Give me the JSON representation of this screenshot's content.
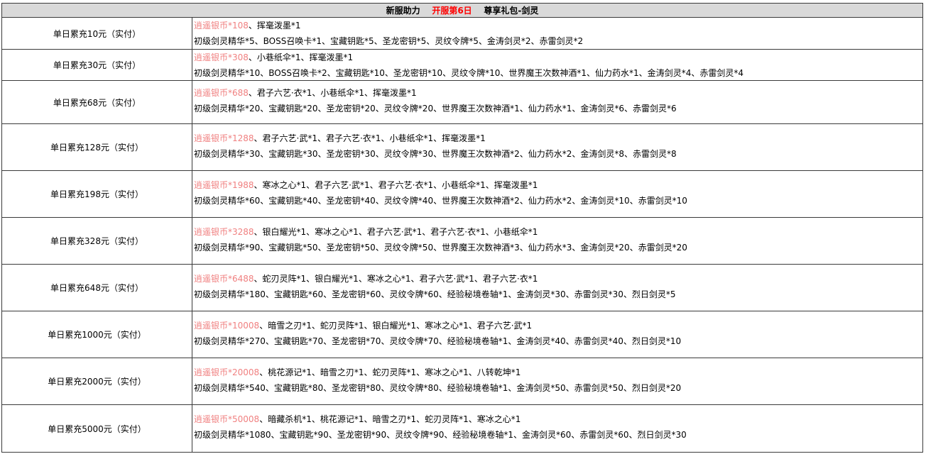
{
  "title": {
    "part1": "新服助力",
    "part2": "开服第6日",
    "part3": "尊享礼包-剑灵"
  },
  "colors": {
    "header_bg": "#d9d9d9",
    "title_red": "#ff0000",
    "highlight_pink": "#f08080",
    "border": "#3a3a3a"
  },
  "rows": [
    {
      "tier": "单日累充10元（实付）",
      "highlight": "逍遥银币*108",
      "line1_rest": "、挥毫泼墨*1",
      "line2": "初级剑灵精华*5、BOSS召唤卡*1、宝藏钥匙*5、圣龙密钥*5、灵纹令牌*5、金涛剑灵*2、赤雷剑灵*2"
    },
    {
      "tier": "单日累充30元（实付）",
      "highlight": "逍遥银币*308",
      "line1_rest": "、小巷纸伞*1、挥毫泼墨*1",
      "line2": "初级剑灵精华*10、BOSS召唤卡*2、宝藏钥匙*10、圣龙密钥*10、灵纹令牌*10、世界魔王次数神酒*1、仙力药水*1、金涛剑灵*4、赤雷剑灵*4"
    },
    {
      "tier": "单日累充68元（实付）",
      "highlight": "逍遥银币*688",
      "line1_rest": "、君子六艺·衣*1、小巷纸伞*1、挥毫泼墨*1",
      "line2": "初级剑灵精华*20、宝藏钥匙*20、圣龙密钥*20、灵纹令牌*20、世界魔王次数神酒*1、仙力药水*1、金涛剑灵*6、赤雷剑灵*6"
    },
    {
      "tier": "单日累充128元（实付）",
      "highlight": "逍遥银币*1288",
      "line1_rest": "、君子六艺·武*1、君子六艺·衣*1、小巷纸伞*1、挥毫泼墨*1",
      "line2": "初级剑灵精华*30、宝藏钥匙*30、圣龙密钥*30、灵纹令牌*30、世界魔王次数神酒*2、仙力药水*2、金涛剑灵*8、赤雷剑灵*8"
    },
    {
      "tier": "单日累充198元（实付）",
      "highlight": "逍遥银币*1988",
      "line1_rest": "、寒冰之心*1、君子六艺·武*1、君子六艺·衣*1、小巷纸伞*1、挥毫泼墨*1",
      "line2": "初级剑灵精华*60、宝藏钥匙*40、圣龙密钥*40、灵纹令牌*40、世界魔王次数神酒*2、仙力药水*2、金涛剑灵*10、赤雷剑灵*10"
    },
    {
      "tier": "单日累充328元（实付）",
      "highlight": "逍遥银币*3288",
      "line1_rest": "、银白耀光*1、寒冰之心*1、君子六艺·武*1、君子六艺·衣*1、小巷纸伞*1",
      "line2": "初级剑灵精华*90、宝藏钥匙*50、圣龙密钥*50、灵纹令牌*50、世界魔王次数神酒*3、仙力药水*3、金涛剑灵*20、赤雷剑灵*20"
    },
    {
      "tier": "单日累充648元（实付）",
      "highlight": "逍遥银币*6488",
      "line1_rest": "、蛇刃灵阵*1、银白耀光*1、寒冰之心*1、君子六艺·武*1、君子六艺·衣*1",
      "line2": "初级剑灵精华*180、宝藏钥匙*60、圣龙密钥*60、灵纹令牌*60、经验秘境卷轴*1、金涛剑灵*30、赤雷剑灵*30、烈日剑灵*5"
    },
    {
      "tier": "单日累充1000元（实付）",
      "highlight": "逍遥银币*10008",
      "line1_rest": "、暗雪之刃*1、蛇刃灵阵*1、银白耀光*1、寒冰之心*1、君子六艺·武*1",
      "line2": "初级剑灵精华*270、宝藏钥匙*70、圣龙密钥*70、灵纹令牌*70、经验秘境卷轴*1、金涛剑灵*40、赤雷剑灵*40、烈日剑灵*10"
    },
    {
      "tier": "单日累充2000元（实付）",
      "highlight": "逍遥银币*20008",
      "line1_rest": "、桃花源记*1、暗雪之刃*1、蛇刃灵阵*1、寒冰之心*1、八转乾坤*1",
      "line2": "初级剑灵精华*540、宝藏钥匙*80、圣龙密钥*80、灵纹令牌*80、经验秘境卷轴*1、金涛剑灵*50、赤雷剑灵*50、烈日剑灵*20"
    },
    {
      "tier": "单日累充5000元（实付）",
      "highlight": "逍遥银币*50008",
      "line1_rest": "、暗藏杀机*1、桃花源记*1、暗雪之刃*1、蛇刃灵阵*1、寒冰之心*1",
      "line2": "初级剑灵精华*1080、宝藏钥匙*90、圣龙密钥*90、灵纹令牌*90、经验秘境卷轴*1、金涛剑灵*60、赤雷剑灵*60、烈日剑灵*30"
    }
  ]
}
